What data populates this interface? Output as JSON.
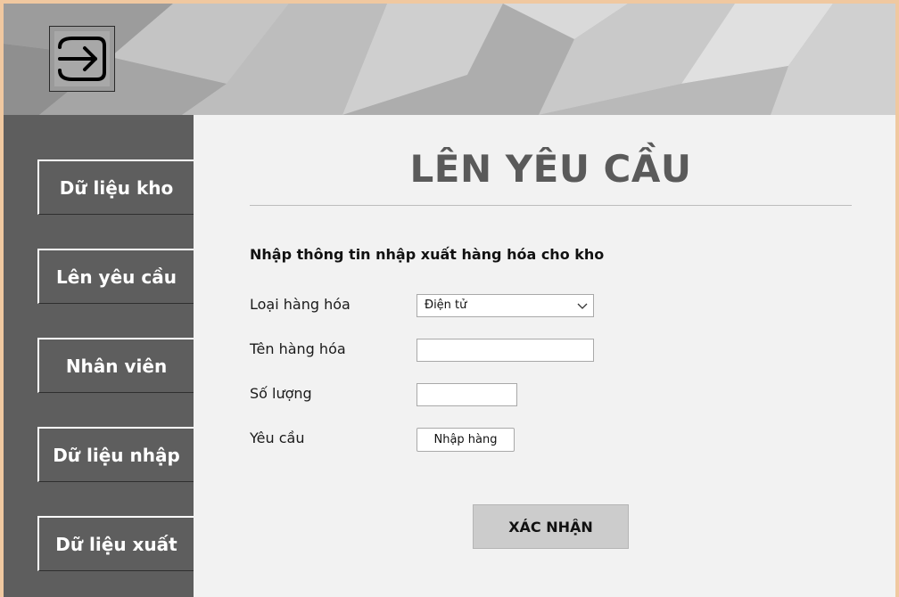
{
  "header": {
    "logout_icon": "logout-arrow-icon"
  },
  "sidebar": {
    "items": [
      {
        "label": "Dữ liệu kho"
      },
      {
        "label": "Lên yêu cầu"
      },
      {
        "label": "Nhân viên"
      },
      {
        "label": "Dữ liệu nhập"
      },
      {
        "label": "Dữ liệu xuất"
      }
    ]
  },
  "main": {
    "title": "LÊN YÊU CẦU",
    "subtitle": "Nhập thông tin nhập xuất hàng hóa cho kho",
    "form": {
      "category_label": "Loại hàng hóa",
      "category_value": "Điện tử",
      "name_label": "Tên hàng hóa",
      "name_value": "",
      "quantity_label": "Số lượng",
      "quantity_value": "",
      "request_label": "Yêu cầu",
      "request_button": "Nhập hàng"
    },
    "confirm_label": "XÁC NHẬN"
  },
  "colors": {
    "sidebar_bg": "#5e5e5e",
    "main_bg": "#f2f2f2",
    "title": "#5a5a5a",
    "window_border": "#f0c8a0"
  }
}
